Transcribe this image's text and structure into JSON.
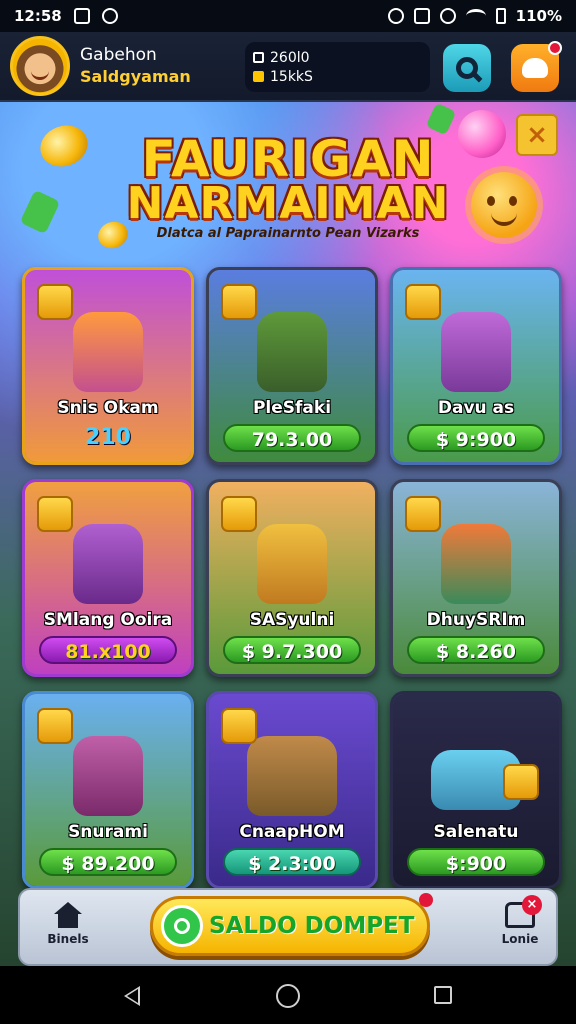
{
  "status_bar": {
    "time": "12:58",
    "battery": "110%"
  },
  "header": {
    "username": "Gabehon",
    "user_subtitle": "Saldgyaman",
    "wallet_line1": "260l0",
    "wallet_line2": "15kkS"
  },
  "banner": {
    "title_line1": "FAURIGAN",
    "title_line2": "NARMAIMAN",
    "subtitle": "Dlatca al Paprainarnto Pean Vizarks"
  },
  "cards": [
    {
      "title": "Snis Okam",
      "price": "210",
      "price_prefix": "",
      "style": "gold"
    },
    {
      "title": "PleSfaki",
      "price": "79.3.00",
      "price_prefix": "",
      "style": "green"
    },
    {
      "title": "Davu as",
      "price": "$ 9:900",
      "price_prefix": "",
      "style": "green"
    },
    {
      "title": "SMlang Ooira",
      "price": "81.x100",
      "price_prefix": "",
      "style": "purple"
    },
    {
      "title": "SASyulni",
      "price": "$ 9.7.300",
      "price_prefix": "",
      "style": "green"
    },
    {
      "title": "DhuySRIm",
      "price": "$ 8.260",
      "price_prefix": "",
      "style": "green"
    },
    {
      "title": "Snurami",
      "price": "$ 89.200",
      "price_prefix": "",
      "style": "green"
    },
    {
      "title": "CnaapHOM",
      "price": "$ 2.3:00",
      "price_prefix": "",
      "style": "teal"
    },
    {
      "title": "Salenatu",
      "price": "$:900",
      "price_prefix": "",
      "style": "green"
    }
  ],
  "bottom_nav": {
    "home_label": "Binels",
    "cta_label": "SALDO DOMPET",
    "right_label": "Lonie"
  },
  "colors": {
    "accent_gold": "#ffd21f",
    "price_green": "#2b9a22",
    "price_purple": "#8a1bb0",
    "notification_red": "#e3173a"
  }
}
